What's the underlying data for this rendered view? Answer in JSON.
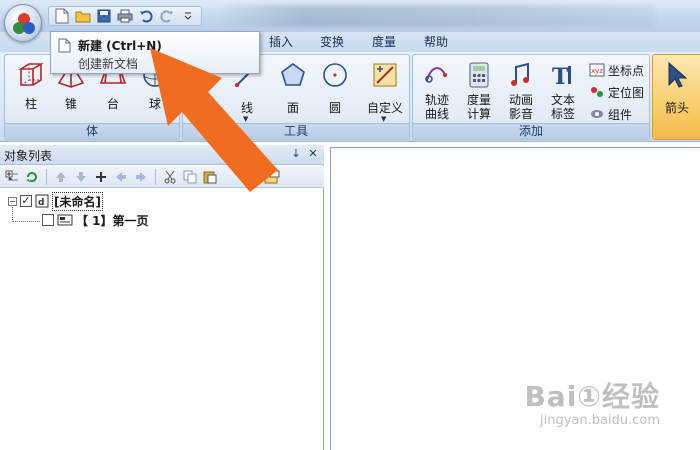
{
  "quick_access": {
    "buttons": [
      {
        "name": "new-document-icon"
      },
      {
        "name": "open-folder-icon"
      },
      {
        "name": "save-icon"
      },
      {
        "name": "print-icon"
      },
      {
        "name": "undo-icon"
      },
      {
        "name": "redo-icon"
      },
      {
        "name": "customize-dropdown-icon"
      }
    ]
  },
  "menu": {
    "tabs": [
      "插入",
      "变换",
      "度量",
      "帮助"
    ]
  },
  "tooltip": {
    "title": "新建 (Ctrl+N)",
    "description": "创建新文档"
  },
  "ribbon": {
    "groups": {
      "solid": {
        "label": "体",
        "buttons": [
          "柱",
          "锥",
          "台",
          "球"
        ]
      },
      "tools": {
        "label": "工具",
        "buttons": [
          "线",
          "面",
          "圆",
          "自定义"
        ]
      },
      "add": {
        "label": "添加",
        "buttons": [
          {
            "line1": "轨迹",
            "line2": "曲线"
          },
          {
            "line1": "度量",
            "line2": "计算"
          },
          {
            "line1": "动画",
            "line2": "影音"
          },
          {
            "line1": "文本",
            "line2": "标签"
          }
        ],
        "small_buttons": [
          "坐标点",
          "定位图",
          "组件"
        ]
      },
      "select": {
        "buttons": [
          "箭头"
        ]
      }
    }
  },
  "object_panel": {
    "title": "对象列表",
    "pin_symbol": "↓",
    "close_symbol": "✕",
    "tree": {
      "root": {
        "label": "[未命名]",
        "checked": true,
        "toggle": "−"
      },
      "child": {
        "label": "【 1】第一页",
        "checked": false
      }
    }
  },
  "watermark": {
    "brand": "Bai①经验",
    "url": "jingyan.baidu.com"
  },
  "colors": {
    "annotation_arrow": "#f26c1f",
    "ribbon_bg": "#dbe6f4",
    "accent_blue": "#1e3d6b"
  }
}
